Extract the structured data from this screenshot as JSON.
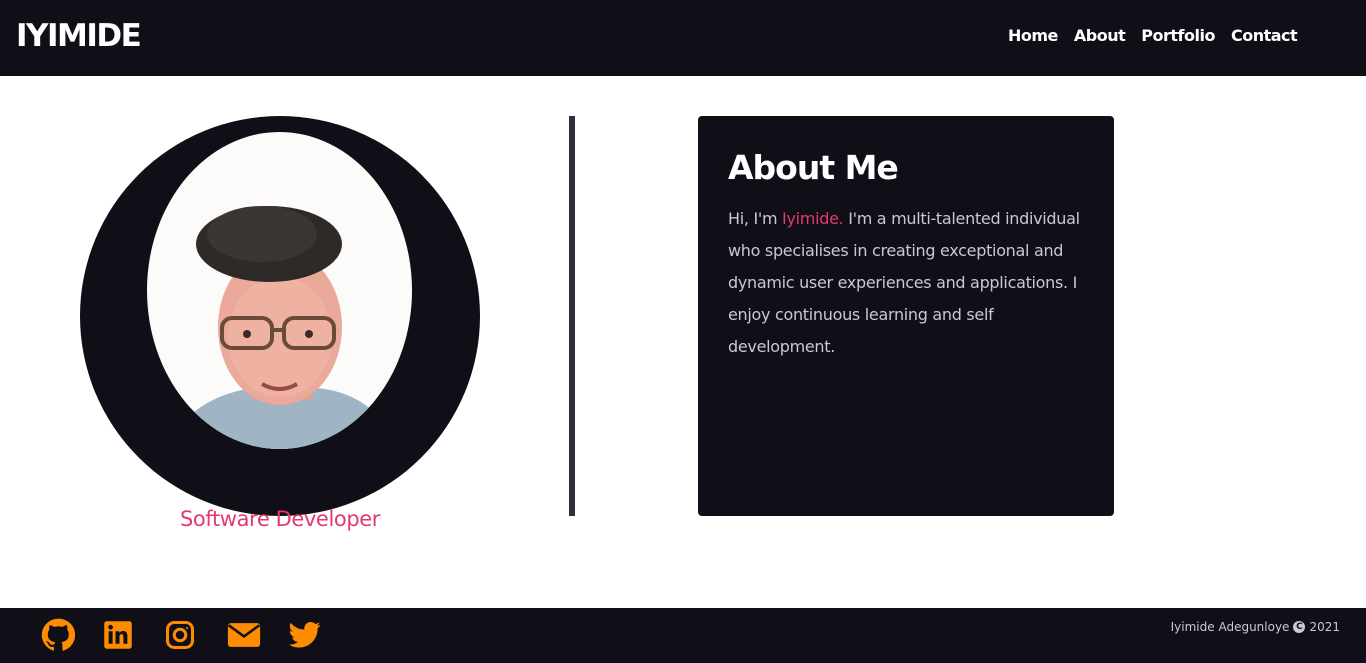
{
  "brand": "IYIMIDE",
  "nav": {
    "home": "Home",
    "about": "About",
    "portfolio": "Portfolio",
    "contact": "Contact"
  },
  "profile": {
    "role": "Software Developer"
  },
  "about": {
    "title": "About Me",
    "intro": "Hi, I'm ",
    "name": "Iyimide.",
    "body": " I'm a multi-talented individual who specialises in creating exceptional and dynamic user experiences and applications. I enjoy continuous learning and self development."
  },
  "footer": {
    "socials": [
      "github-icon",
      "linkedin-icon",
      "instagram-icon",
      "mail-icon",
      "twitter-icon"
    ],
    "copyright_name": "Iyimide Adegunloye",
    "copyright_year": "2021"
  },
  "colors": {
    "dark": "#100f18",
    "accent_pink": "#e33a6e",
    "accent_orange": "#ff8c00",
    "divider": "#2d2f3d"
  }
}
